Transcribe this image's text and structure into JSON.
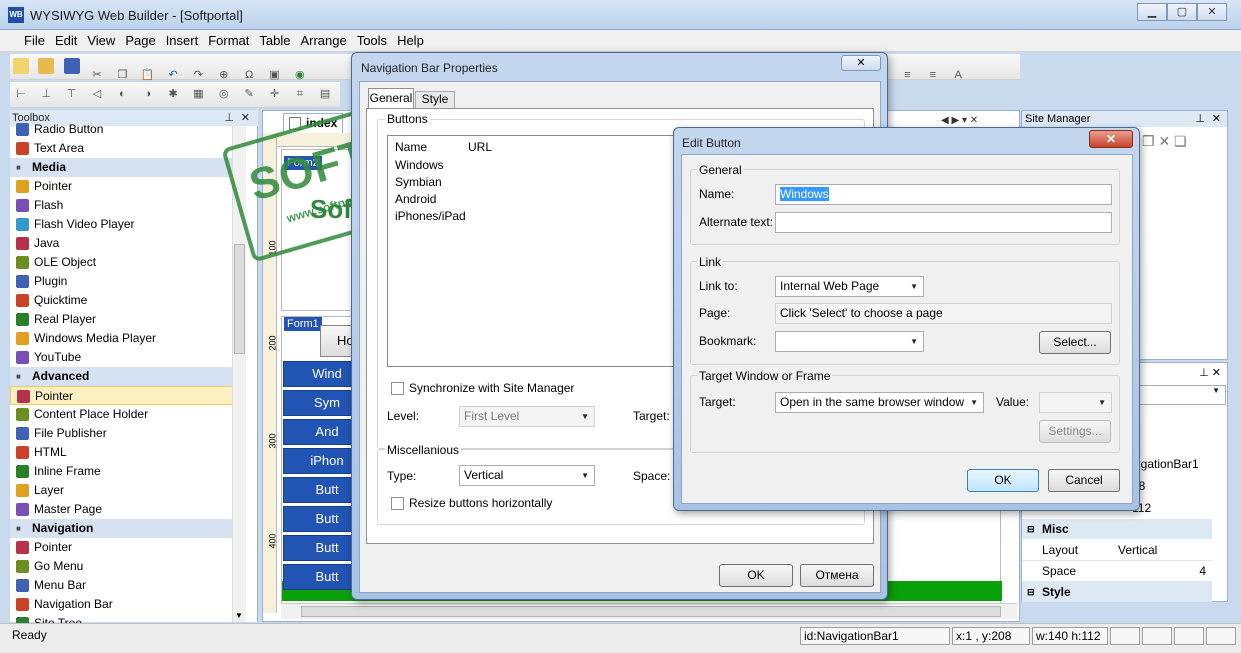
{
  "window": {
    "title": "WYSIWYG Web Builder - [Softportal]"
  },
  "menu": [
    "File",
    "Edit",
    "View",
    "Page",
    "Insert",
    "Format",
    "Table",
    "Arrange",
    "Tools",
    "Help"
  ],
  "toolbox": {
    "title": "Toolbox",
    "items": [
      {
        "label": "Radio Button",
        "kind": "item"
      },
      {
        "label": "Text Area",
        "kind": "item"
      },
      {
        "label": "Media",
        "kind": "cat"
      },
      {
        "label": "Pointer",
        "kind": "item"
      },
      {
        "label": "Flash",
        "kind": "item"
      },
      {
        "label": "Flash Video Player",
        "kind": "item"
      },
      {
        "label": "Java",
        "kind": "item"
      },
      {
        "label": "OLE Object",
        "kind": "item"
      },
      {
        "label": "Plugin",
        "kind": "item"
      },
      {
        "label": "Quicktime",
        "kind": "item"
      },
      {
        "label": "Real Player",
        "kind": "item"
      },
      {
        "label": "Windows Media Player",
        "kind": "item"
      },
      {
        "label": "YouTube",
        "kind": "item"
      },
      {
        "label": "Advanced",
        "kind": "cat"
      },
      {
        "label": "Pointer",
        "kind": "item",
        "selected": true
      },
      {
        "label": "Content Place Holder",
        "kind": "item"
      },
      {
        "label": "File Publisher",
        "kind": "item"
      },
      {
        "label": "HTML",
        "kind": "item"
      },
      {
        "label": "Inline Frame",
        "kind": "item"
      },
      {
        "label": "Layer",
        "kind": "item"
      },
      {
        "label": "Master Page",
        "kind": "item"
      },
      {
        "label": "Navigation",
        "kind": "cat"
      },
      {
        "label": "Pointer",
        "kind": "item"
      },
      {
        "label": "Go Menu",
        "kind": "item"
      },
      {
        "label": "Menu Bar",
        "kind": "item"
      },
      {
        "label": "Navigation Bar",
        "kind": "item"
      },
      {
        "label": "Site Tree",
        "kind": "item"
      }
    ]
  },
  "editor": {
    "tab": "index",
    "form2": "Form2",
    "form1": "Form1",
    "home_btn": "Ho",
    "nav_buttons": [
      "Wind",
      "Sym",
      "And",
      "iPhon",
      "Butt",
      "Butt",
      "Butt",
      "Butt"
    ],
    "ruler_marks": [
      "100",
      "200",
      "300",
      "400"
    ],
    "brand_text": "Sof"
  },
  "site_manager": {
    "title": "Site Manager"
  },
  "properties": {
    "rows": [
      {
        "name": "",
        "value": "vigationBar1"
      },
      {
        "name": "",
        "value": "08"
      },
      {
        "name": "",
        "value": "112"
      }
    ],
    "section_misc": "Misc",
    "layout_label": "Layout",
    "layout_value": "Vertical",
    "space_label": "Space",
    "space_value": "4",
    "section_style": "Style"
  },
  "status": {
    "text": "Ready",
    "id": "id:NavigationBar1",
    "coords": "x:1 , y:208",
    "size": "w:140 h:112"
  },
  "nav_dialog": {
    "title": "Navigation Bar Properties",
    "tabs": [
      "General",
      "Style"
    ],
    "buttons_group": "Buttons",
    "col_name": "Name",
    "col_url": "URL",
    "buttons": [
      "Windows",
      "Symbian",
      "Android",
      "iPhones/iPad"
    ],
    "sync_label": "Synchronize with Site Manager",
    "level_label": "Level:",
    "level_value": "First Level",
    "target_label": "Target:",
    "misc_group": "Miscellanious",
    "type_label": "Type:",
    "type_value": "Vertical",
    "space_label": "Space:",
    "resize_label": "Resize buttons horizontally",
    "ok": "OK",
    "cancel": "Отмена"
  },
  "edit_dialog": {
    "title": "Edit Button",
    "general_group": "General",
    "name_label": "Name:",
    "name_value": "Windows",
    "alt_label": "Alternate text:",
    "alt_value": "",
    "link_group": "Link",
    "linkto_label": "Link to:",
    "linkto_value": "Internal Web Page",
    "page_label": "Page:",
    "page_value": "Click 'Select' to choose a page",
    "bookmark_label": "Bookmark:",
    "bookmark_value": "",
    "select_btn": "Select...",
    "target_group": "Target Window or Frame",
    "target_label": "Target:",
    "target_value": "Open in the same browser window",
    "value_label": "Value:",
    "settings_btn": "Settings...",
    "ok": "OK",
    "cancel": "Cancel"
  },
  "watermark": {
    "main": "SOFTPORTAL",
    "tm": "TM",
    "url": "www.softportal.com"
  }
}
